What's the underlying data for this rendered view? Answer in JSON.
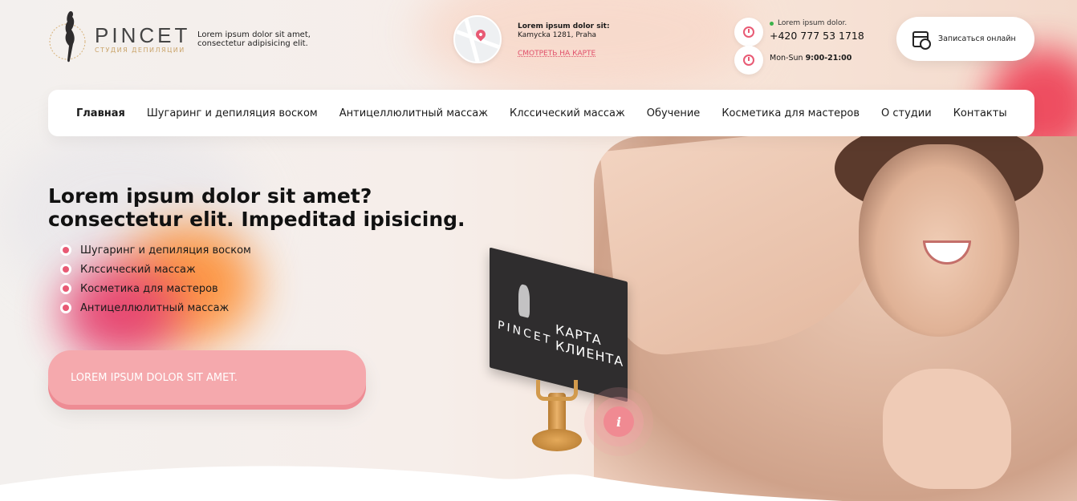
{
  "header": {
    "brand": "PINCET",
    "brand_sub": "СТУДИЯ ДЕПИЛЯЦИИ",
    "tagline": "Lorem ipsum dolor sit amet, consectetur adipisicing elit.",
    "address_title": "Lorem ipsum dolor sit:",
    "address_line": "Kamycka 1281, Praha",
    "map_link": "СМОТРЕТЬ НА КАРТЕ",
    "status_text": "Lorem ipsum dolor.",
    "phone": "+420 777 53 1718",
    "hours_days": "Mon-Sun",
    "hours_time": "9:00-21:00",
    "book_button": "Записаться онлайн"
  },
  "nav": {
    "items": [
      {
        "label": "Главная"
      },
      {
        "label": "Шугаринг и депиляция воском"
      },
      {
        "label": "Антицеллюлитный массаж"
      },
      {
        "label": "Клссический массаж"
      },
      {
        "label": "Обучение"
      },
      {
        "label": "Косметика для мастеров"
      },
      {
        "label": "О студии"
      },
      {
        "label": "Контакты"
      }
    ]
  },
  "hero": {
    "title_line1_regular": "Lorem ipsum ",
    "title_line1_bold": "dolor sit amet?",
    "title_line2_regular": "consectetur elit. ",
    "title_line2_bold": "Impeditad ipisicing.",
    "services": [
      {
        "label": "Шугаринг и депиляция воском"
      },
      {
        "label": "Клссический массаж"
      },
      {
        "label": "Косметика для мастеров"
      },
      {
        "label": "Антицеллюлитный массаж"
      }
    ],
    "cta_label": "LOREM IPSUM DOLOR SIT AMET."
  },
  "card": {
    "brand": "PINCET",
    "title_line1": "КАРТА",
    "title_line2": "КЛИЕНТА",
    "info_icon": "i"
  },
  "colors": {
    "accent": "#e85a74",
    "cta": "#f5a9ad",
    "status_online": "#3bb24a"
  }
}
